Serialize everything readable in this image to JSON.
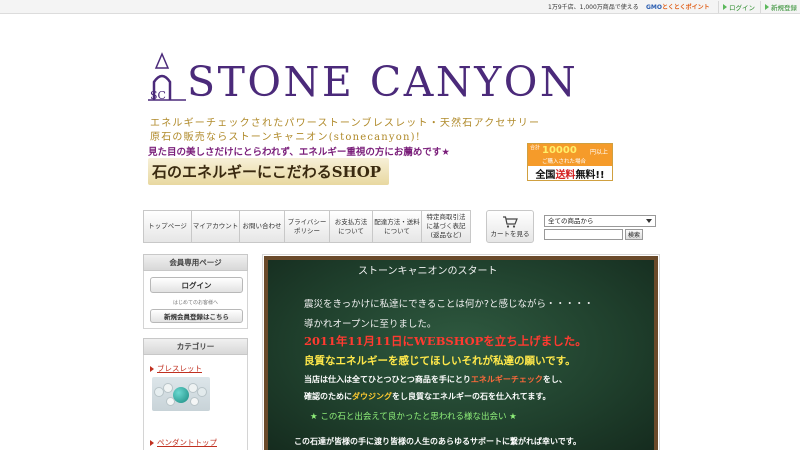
{
  "topbar": {
    "promo": "1万9千店、1,000万商品で使える",
    "gmo_blue": "GMO",
    "gmo_red": "とくとくポイント",
    "login": "ログイン",
    "register": "新規登録"
  },
  "header": {
    "logo_text": "STONE CANYON",
    "logo_mark_letters": "SC",
    "tagline1": "エネルギーチェックされたパワーストーンブレスレット・天然石アクセサリー",
    "tagline2": "原石の販売ならストーンキャニオン(stonecanyon)!",
    "tagline3": "見た目の美しさだけにとらわれず、エネルギー重視の方にお薦めです★",
    "shop_banner": "石のエネルギーにこだわるSHOP"
  },
  "shipping": {
    "prefix": "合計",
    "amount": "10000",
    "unit": "円以上",
    "condition": "ご購入された場合",
    "free_a": "全国",
    "free_b": "送料",
    "free_c": "無料!!"
  },
  "nav": [
    {
      "label": "トップページ"
    },
    {
      "label": "マイアカウント"
    },
    {
      "label": "お問い合わせ"
    },
    {
      "label": "プライバシー\nポリシー"
    },
    {
      "label": "お支払方法\nについて"
    },
    {
      "label": "配達方法・送料\nについて"
    },
    {
      "label": "特定商取引法\nに基づく表記\n(返品など)"
    }
  ],
  "cart": {
    "label": "カートを見る"
  },
  "search": {
    "select_value": "全ての商品から",
    "button": "検索"
  },
  "sidebar": {
    "member_header": "会員専用ページ",
    "login_button": "ログイン",
    "first_note": "はじめてのお客様へ",
    "register_button": "新規会員登録はこちら",
    "category_header": "カテゴリー",
    "categories": [
      {
        "label": "ブレスレット"
      },
      {
        "label": "ペンダントトップ"
      }
    ]
  },
  "board": {
    "title": "ストーンキャニオンのスタート",
    "line1": "震災をきっかけに私達にできることは何か?と感じながら・・・・・",
    "line2": "導かれオープンに至りました。",
    "line3": "2011年11月11日にWEBSHOPを立ち上げました。",
    "line4": "良質なエネルギーを感じてほしいそれが私達の願いです。",
    "line5a": "当店は仕入は全てひとつひとつ商品を手にとり",
    "line5b": "エネルギーチェック",
    "line5c": "をし、",
    "line6a": "確認のために",
    "line6b": "ダウジング",
    "line6c": "をし良質なエネルギーの石を仕入れてます。",
    "line7": "★ この石と出会えて良かったと思われる様な出会い ★",
    "line8": "この石達が皆様の手に渡り皆様の人生のあらゆるサポートに繋がれば幸いです。"
  },
  "colors": {
    "brand_purple": "#4b2a7a",
    "tagline_gold": "#b08a2a",
    "accent_red": "#c03020",
    "board_green": "#1f3f2c"
  }
}
